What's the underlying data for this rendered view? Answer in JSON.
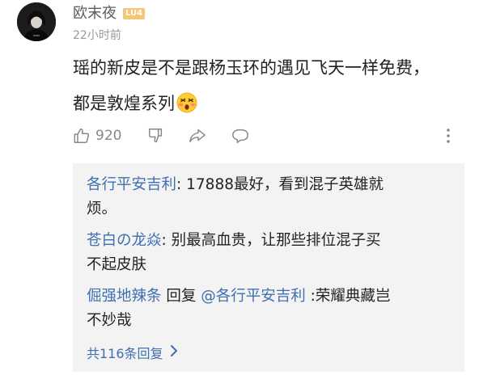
{
  "comment": {
    "username": "欧末夜",
    "level_badge": "LU4",
    "timestamp": "22小时前",
    "text_line1": "瑶的新皮是不是跟杨玉环的遇见飞天一样免费，",
    "text_line2": "都是敦煌系列",
    "emoji": "astonished-face-emoji",
    "like_count": "920"
  },
  "replies": [
    {
      "nick": "各行平安吉利",
      "sep": ": ",
      "text_line1": "17888最好，看到混子英雄就",
      "text_line2": "烦。"
    },
    {
      "nick": "苍白の龙焱",
      "sep": ": ",
      "text_line1": "别最高血贵，让那些排位混子买",
      "text_line2": "不起皮肤"
    },
    {
      "nick": "倔强地辣条",
      "reply_word": " 回复 ",
      "target": "@各行平安吉利",
      "sep": " :",
      "text_line1": "荣耀典藏岂",
      "text_line2": "不妙哉"
    }
  ],
  "more_replies_label": "共116条回复",
  "colors": {
    "link_blue": "#3f6fb0",
    "reply_bg": "#f3f3f3",
    "badge": "#f5c57a",
    "icon_gray": "#888888"
  },
  "icons": [
    "thumbs-up-icon",
    "thumbs-down-icon",
    "share-icon",
    "comment-icon",
    "more-vertical-icon",
    "chevron-right-icon"
  ]
}
